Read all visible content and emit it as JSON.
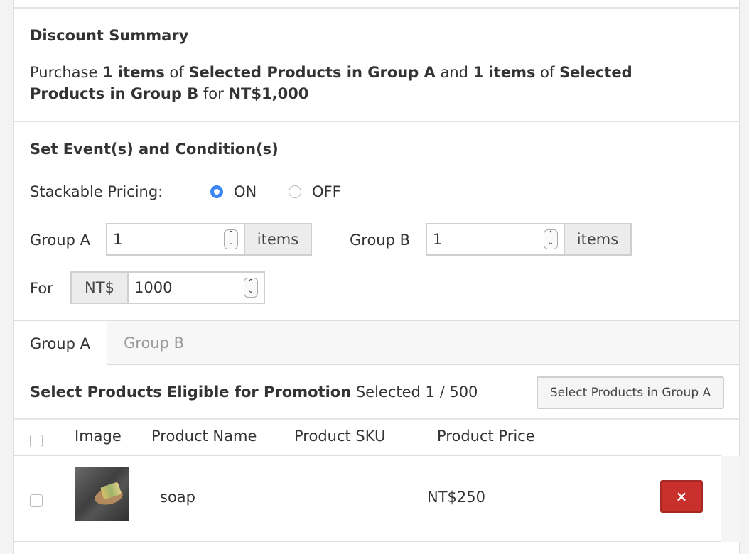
{
  "summary": {
    "title": "Discount Summary",
    "text_purchase": "Purchase ",
    "group_a_qty": "1 items",
    "text_of_1": " of ",
    "group_a_name": "Selected Products in Group A",
    "text_and": " and ",
    "group_b_qty": "1 items",
    "text_of_2": " of ",
    "group_b_name": "Selected Products in Group B",
    "text_for": " for ",
    "price": "NT$1,000"
  },
  "conditions": {
    "title": "Set Event(s) and Condition(s)",
    "stackable_label": "Stackable Pricing:",
    "option_on": "ON",
    "option_off": "OFF",
    "selected": "ON",
    "group_a_label": "Group A",
    "group_a_value": "1",
    "group_b_label": "Group B",
    "group_b_value": "1",
    "items_unit": "items",
    "for_label": "For",
    "currency": "NT$",
    "price_value": "1000"
  },
  "tabs": [
    {
      "label": "Group A",
      "active": true
    },
    {
      "label": "Group B",
      "active": false
    }
  ],
  "products": {
    "title": "Select Products Eligible for Promotion",
    "selected_text": "Selected 1 / 500",
    "select_button": "Select Products in Group A",
    "columns": [
      "Image",
      "Product Name",
      "Product SKU",
      "Product Price"
    ],
    "rows": [
      {
        "name": "soap",
        "sku": "",
        "price": "NT$250",
        "image_icon": "soap-product-photo"
      }
    ],
    "remove_icon": "×"
  },
  "colors": {
    "accent": "#3a86f5",
    "danger": "#c9302c"
  }
}
